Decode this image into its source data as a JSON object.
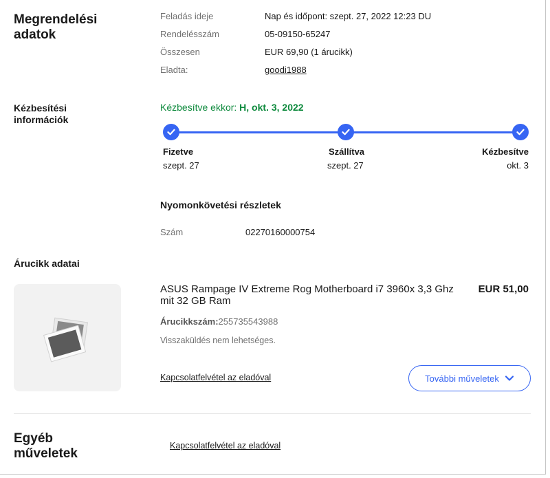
{
  "order": {
    "title": "Megrendelési adatok",
    "rows": [
      {
        "label": "Feladás ideje",
        "value": "Nap és időpont: szept. 27, 2022 12:23 DU"
      },
      {
        "label": "Rendelésszám",
        "value": "05-09150-65247"
      },
      {
        "label": "Összesen",
        "value": "EUR 69,90 (1 árucikk)"
      },
      {
        "label": "Eladta:",
        "value": "goodi1988"
      }
    ]
  },
  "delivery": {
    "title": "Kézbesítési információk",
    "status_prefix": "Kézbesítve ekkor: ",
    "status_date": "H, okt. 3, 2022",
    "steps": [
      {
        "name": "Fizetve",
        "date": "szept. 27"
      },
      {
        "name": "Szállítva",
        "date": "szept. 27"
      },
      {
        "name": "Kézbesítve",
        "date": "okt. 3"
      }
    ],
    "tracking_title": "Nyomonkövetési részletek",
    "tracking_label": "Szám",
    "tracking_number": "02270160000754"
  },
  "item": {
    "title": "Árucikk adatai",
    "name": "ASUS Rampage IV Extreme Rog Motherboard i7 3960x 3,3 Ghz mit 32 GB Ram",
    "price": "EUR 51,00",
    "number_label": "Árucikkszám:",
    "number_value": "255735543988",
    "return_text": "Visszaküldés nem lehetséges.",
    "contact_link": "Kapcsolatfelvétel az eladóval",
    "more_button": "További műveletek"
  },
  "other": {
    "title": "Egyéb műveletek",
    "contact_link": "Kapcsolatfelvétel az eladóval"
  },
  "colors": {
    "accent": "#3665f3",
    "success": "#0e8a3d"
  }
}
